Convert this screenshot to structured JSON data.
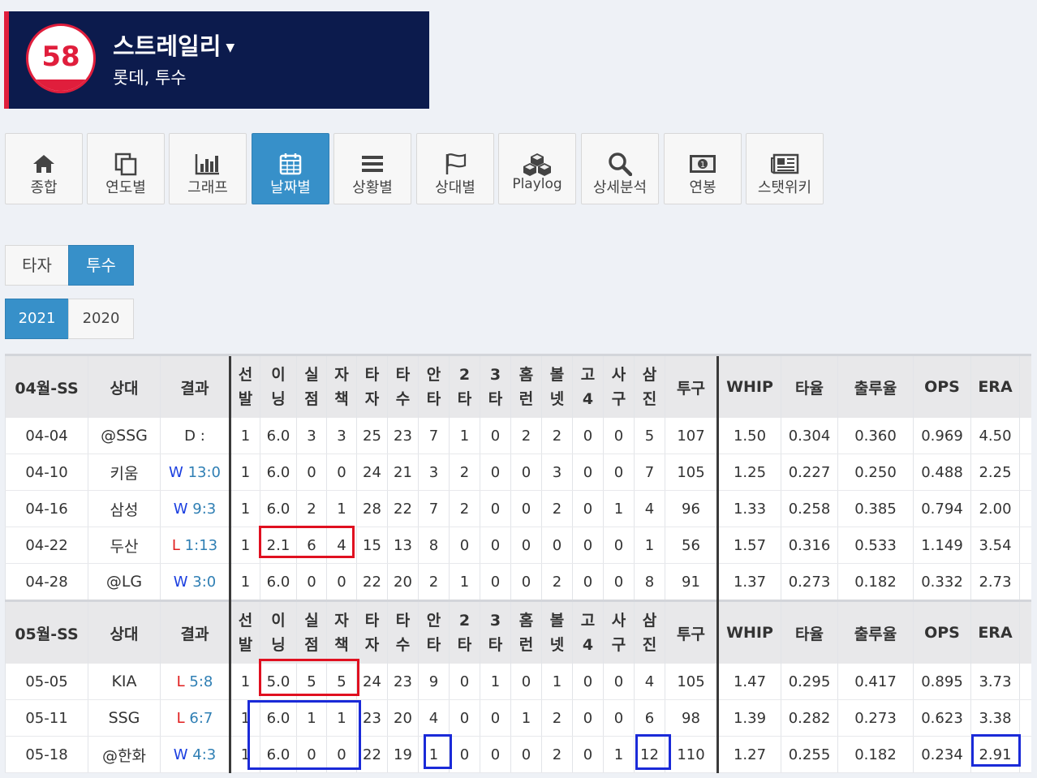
{
  "player": {
    "number": "58",
    "name": "스트레일리",
    "info": "롯데, 투수"
  },
  "tabs": [
    {
      "label": "종합",
      "icon": "home-icon"
    },
    {
      "label": "연도별",
      "icon": "copy-icon"
    },
    {
      "label": "그래프",
      "icon": "bar-chart-icon"
    },
    {
      "label": "날짜별",
      "icon": "calendar-icon",
      "active": true
    },
    {
      "label": "상황별",
      "icon": "list-icon"
    },
    {
      "label": "상대별",
      "icon": "flag-icon"
    },
    {
      "label": "Playlog",
      "icon": "cubes-icon"
    },
    {
      "label": "상세분석",
      "icon": "search-icon"
    },
    {
      "label": "연봉",
      "icon": "money-icon"
    },
    {
      "label": "스탯위키",
      "icon": "newspaper-icon"
    }
  ],
  "role_toggle": {
    "batter": "타자",
    "pitcher": "투수",
    "active": "pitcher"
  },
  "year_toggle": {
    "years": [
      "2021",
      "2020"
    ],
    "active": "2021"
  },
  "table": {
    "columns": [
      "상대",
      "결과",
      "선발",
      "이닝",
      "실점",
      "자책",
      "타자",
      "타수",
      "안타",
      "2타",
      "3타",
      "홈런",
      "볼넷",
      "고4",
      "사구",
      "삼진",
      "투구",
      "WHIP",
      "타율",
      "출루율",
      "OPS",
      "ERA"
    ],
    "groups": [
      {
        "month": "04월-SS",
        "rows": [
          {
            "date": "04-04",
            "opp": "@SSG",
            "res_wl": "D",
            "res_score": ":",
            "cells": [
              "1",
              "6.0",
              "3",
              "3",
              "25",
              "23",
              "7",
              "1",
              "0",
              "2",
              "2",
              "0",
              "0",
              "5",
              "107",
              "1.50",
              "0.304",
              "0.360",
              "0.969",
              "4.50"
            ]
          },
          {
            "date": "04-10",
            "opp": "키움",
            "res_wl": "W",
            "res_score": "13:0",
            "cells": [
              "1",
              "6.0",
              "0",
              "0",
              "24",
              "21",
              "3",
              "2",
              "0",
              "0",
              "3",
              "0",
              "0",
              "7",
              "105",
              "1.25",
              "0.227",
              "0.250",
              "0.488",
              "2.25"
            ]
          },
          {
            "date": "04-16",
            "opp": "삼성",
            "res_wl": "W",
            "res_score": "9:3",
            "cells": [
              "1",
              "6.0",
              "2",
              "1",
              "28",
              "22",
              "7",
              "2",
              "0",
              "0",
              "2",
              "0",
              "1",
              "4",
              "96",
              "1.33",
              "0.258",
              "0.385",
              "0.794",
              "2.00"
            ]
          },
          {
            "date": "04-22",
            "opp": "두산",
            "res_wl": "L",
            "res_score": "1:13",
            "cells": [
              "1",
              "2.1",
              "6",
              "4",
              "15",
              "13",
              "8",
              "0",
              "0",
              "0",
              "0",
              "0",
              "0",
              "1",
              "56",
              "1.57",
              "0.316",
              "0.533",
              "1.149",
              "3.54"
            ]
          },
          {
            "date": "04-28",
            "opp": "@LG",
            "res_wl": "W",
            "res_score": "3:0",
            "cells": [
              "1",
              "6.0",
              "0",
              "0",
              "22",
              "20",
              "2",
              "1",
              "0",
              "0",
              "2",
              "0",
              "0",
              "8",
              "91",
              "1.37",
              "0.273",
              "0.182",
              "0.332",
              "2.73"
            ]
          }
        ]
      },
      {
        "month": "05월-SS",
        "rows": [
          {
            "date": "05-05",
            "opp": "KIA",
            "res_wl": "L",
            "res_score": "5:8",
            "cells": [
              "1",
              "5.0",
              "5",
              "5",
              "24",
              "23",
              "9",
              "0",
              "1",
              "0",
              "1",
              "0",
              "0",
              "4",
              "105",
              "1.47",
              "0.295",
              "0.417",
              "0.895",
              "3.73"
            ]
          },
          {
            "date": "05-11",
            "opp": "SSG",
            "res_wl": "L",
            "res_score": "6:7",
            "cells": [
              "1",
              "6.0",
              "1",
              "1",
              "23",
              "20",
              "4",
              "0",
              "0",
              "1",
              "2",
              "0",
              "0",
              "6",
              "98",
              "1.39",
              "0.282",
              "0.273",
              "0.623",
              "3.38"
            ]
          },
          {
            "date": "05-18",
            "opp": "@한화",
            "res_wl": "W",
            "res_score": "4:3",
            "cells": [
              "1",
              "6.0",
              "0",
              "0",
              "22",
              "19",
              "1",
              "0",
              "0",
              "0",
              "2",
              "0",
              "1",
              "12",
              "110",
              "1.27",
              "0.255",
              "0.182",
              "0.234",
              "2.91"
            ]
          }
        ]
      }
    ]
  },
  "colors": {
    "navy": "#0c1b4d",
    "accent_red": "#e01e3c",
    "active_blue": "#3790c9",
    "highlight_red": "#e01020",
    "highlight_blue": "#1a2ad8"
  }
}
